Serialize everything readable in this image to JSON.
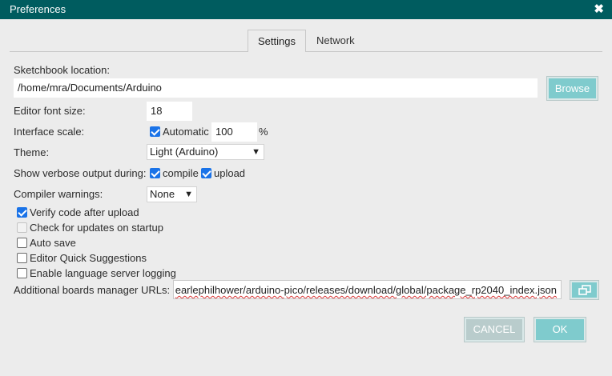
{
  "window": {
    "title": "Preferences",
    "close_icon": "✖"
  },
  "tabs": [
    {
      "label": "Settings"
    },
    {
      "label": "Network"
    }
  ],
  "sketchbook": {
    "label": "Sketchbook location:",
    "value": "/home/mra/Documents/Arduino",
    "browse_label": "Browse"
  },
  "font_size": {
    "label": "Editor font size:",
    "value": "18"
  },
  "interface_scale": {
    "label": "Interface scale:",
    "automatic_label": "Automatic",
    "automatic_checked": true,
    "value": "100",
    "unit": "%"
  },
  "theme": {
    "label": "Theme:",
    "selected": "Light (Arduino)"
  },
  "verbose": {
    "label": "Show verbose output during:",
    "compile_label": "compile",
    "compile_checked": true,
    "upload_label": "upload",
    "upload_checked": true
  },
  "compiler_warnings": {
    "label": "Compiler warnings:",
    "selected": "None"
  },
  "options": [
    {
      "label": "Verify code after upload",
      "checked": true,
      "disabled": false
    },
    {
      "label": "Check for updates on startup",
      "checked": false,
      "disabled": true
    },
    {
      "label": "Auto save",
      "checked": false,
      "disabled": false
    },
    {
      "label": "Editor Quick Suggestions",
      "checked": false,
      "disabled": false
    },
    {
      "label": "Enable language server logging",
      "checked": false,
      "disabled": false
    }
  ],
  "boards_urls": {
    "label": "Additional boards manager URLs:",
    "value": "earlephilhower/arduino-pico/releases/download/global/package_rp2040_index.json"
  },
  "footer": {
    "cancel_label": "CANCEL",
    "ok_label": "OK"
  },
  "colors": {
    "titlebar": "#005c5f",
    "accent": "#7fcbcd",
    "checkbox": "#1a73e8"
  }
}
